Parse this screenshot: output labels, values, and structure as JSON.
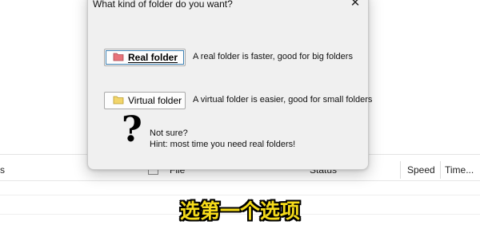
{
  "background_app": {
    "columns": [
      "s",
      "File",
      "Status",
      "Speed",
      "Time..."
    ]
  },
  "dialog": {
    "title": "What kind of folder do you want?",
    "close_label": "✕",
    "real_button": {
      "label": "Real folder",
      "icon": "red-folder-icon"
    },
    "real_description": "A real folder is faster, good for big folders",
    "virtual_button": {
      "label": "Virtual folder",
      "icon": "yellow-folder-icon"
    },
    "virtual_description": "A virtual folder is easier, good for small folders",
    "question_mark": "?",
    "hint_line1": "Not sure?",
    "hint_line2": "Hint: most time you need real folders!"
  },
  "subtitle": "选第一个选项",
  "colors": {
    "real_folder_icon": "#e8737a",
    "virtual_folder_icon": "#f2d56b",
    "subtitle": "#f6dc1a",
    "focus_ring": "#3c7fb1"
  }
}
